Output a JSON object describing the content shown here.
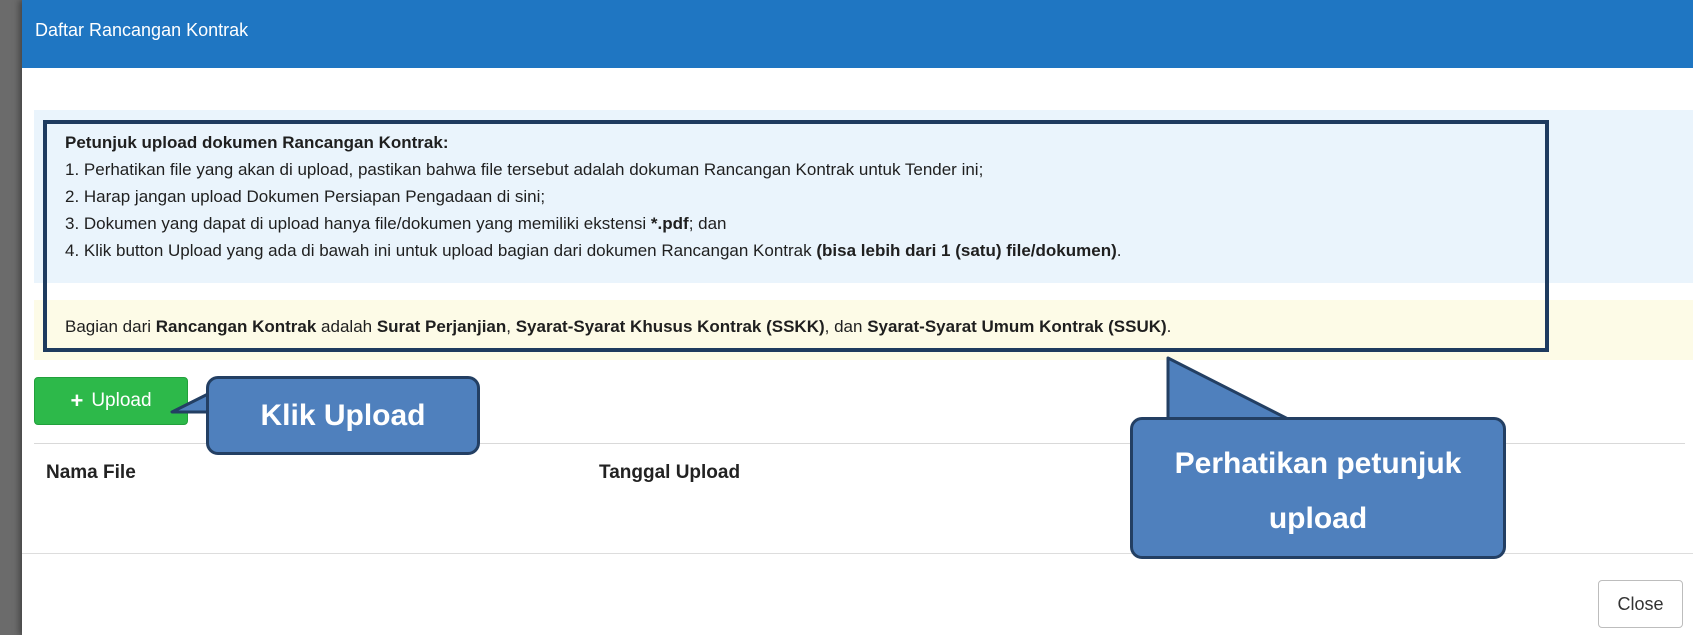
{
  "modal": {
    "title": "Daftar Rancangan Kontrak",
    "close_label": "Close"
  },
  "instructions": {
    "title": "Petunjuk upload dokumen Rancangan Kontrak:",
    "line1": "1. Perhatikan file yang akan di upload, pastikan bahwa file tersebut adalah dokuman Rancangan Kontrak untuk Tender ini;",
    "line2": "2. Harap jangan upload Dokumen Persiapan Pengadaan di sini;",
    "line3_pre": "3. Dokumen yang dapat di upload hanya file/dokumen yang memiliki ekstensi ",
    "line3_bold": "*.pdf",
    "line3_post": "; dan",
    "line4_pre": "4. Klik button Upload yang ada di bawah ini untuk upload bagian dari dokumen Rancangan Kontrak ",
    "line4_bold": "(bisa lebih dari 1 (satu) file/dokumen)",
    "line4_post": ".",
    "note_1": "Bagian dari ",
    "note_2": "Rancangan Kontrak",
    "note_3": " adalah ",
    "note_4": "Surat Perjanjian",
    "note_5": ", ",
    "note_6": "Syarat-Syarat Khusus Kontrak (SSKK)",
    "note_7": ", dan ",
    "note_8": "Syarat-Syarat Umum Kontrak (SSUK)",
    "note_9": "."
  },
  "upload_button": {
    "icon": "plus-icon",
    "label": "Upload",
    "color": "#2db94a"
  },
  "table": {
    "columns": [
      "Nama File",
      "Tanggal Upload"
    ]
  },
  "callouts": {
    "upload": "Klik Upload",
    "guide_line1": "Perhatikan petunjuk",
    "guide_line2": "upload",
    "fill_color": "#4f80bd"
  },
  "header_color": "#1f76c2"
}
